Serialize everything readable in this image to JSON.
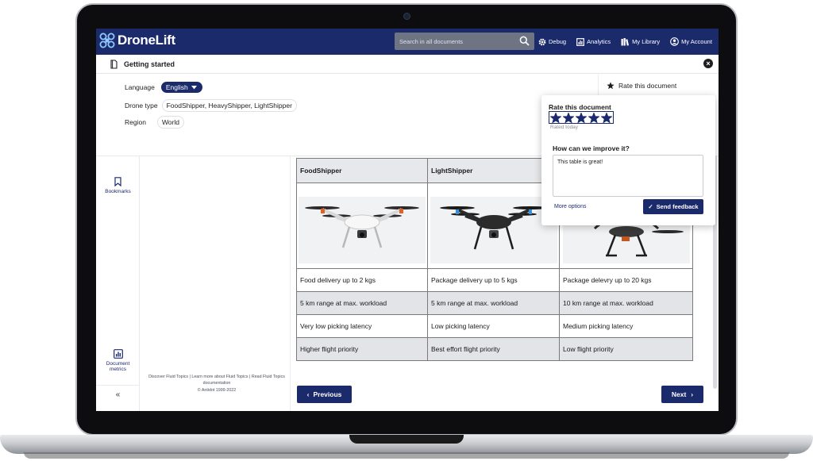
{
  "app": {
    "name": "DroneLift",
    "brand_color": "#1b2a6b"
  },
  "search": {
    "placeholder": "Search in all documents"
  },
  "nav": {
    "debug": "Debug",
    "analytics": "Analytics",
    "library": "My Library",
    "account": "My Account"
  },
  "doc_header": {
    "title": "Getting started"
  },
  "metadata": {
    "language_label": "Language",
    "language_value": "English",
    "drone_type_label": "Drone type",
    "drone_type_value": "FoodShipper, HeavyShipper, LightShipper",
    "region_label": "Region",
    "region_value": "World",
    "rate_link": "Rate this document"
  },
  "sidebar": {
    "bookmarks": "Bookmarks",
    "metrics_line1": "Document",
    "metrics_line2": "metrics",
    "collapse": "«"
  },
  "footer": {
    "links": "Discover Fluid Topics | Learn more about Fluid Topics | Read Fluid Topics documentation",
    "copyright": "© Antidot 1999-2022"
  },
  "table": {
    "headers": [
      "FoodShipper",
      "LightShipper",
      ""
    ],
    "rows": [
      [
        "Food delivery up to 2 kgs",
        "Package delivery up to 5 kgs",
        "Package delevry up to 20 kgs"
      ],
      [
        "5 km range at max. workload",
        "5 km range at max. workload",
        "10 km range at max. workload"
      ],
      [
        "Very low picking latency",
        "Low picking latency",
        "Medium picking latency"
      ],
      [
        "Higher flight priority",
        "Best effort flight priority",
        "Low flight priority"
      ]
    ]
  },
  "pager": {
    "previous": "Previous",
    "next": "Next"
  },
  "rating_popup": {
    "title": "Rate this document",
    "stars": 5,
    "max_stars": 5,
    "rated_text": "Rated today",
    "improve_label": "How can we improve it?",
    "feedback_value": "This table is great!",
    "more_options": "More options",
    "send_label": "Send feedback"
  }
}
